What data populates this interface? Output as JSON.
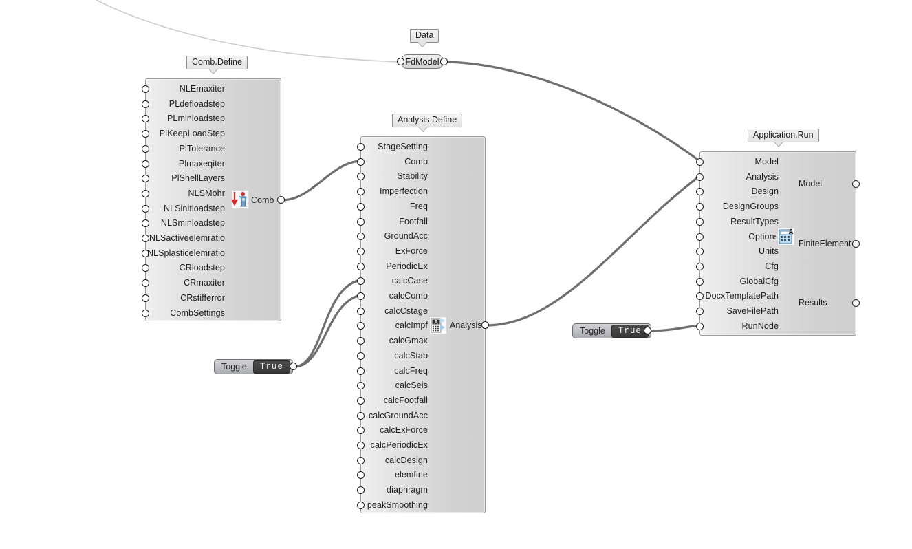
{
  "app": {
    "kind": "node-graph-canvas",
    "background": "#ffffff",
    "wire_color": "#6e6e6e",
    "thin_wire_color": "#c9c9c9"
  },
  "nodes": [
    {
      "id": "comb-define",
      "tag": "Comb.Define",
      "icon_name": "comb-icon",
      "output_label": "Comb",
      "inputs": [
        "NLEmaxiter",
        "PLdefloadstep",
        "PLminloadstep",
        "PlKeepLoadStep",
        "PlTolerance",
        "Plmaxeqiter",
        "PlShellLayers",
        "NLSMohr",
        "NLSinitloadstep",
        "NLSminloadstep",
        "NLSactiveelemratio",
        "NLSplasticelemratio",
        "CRloadstep",
        "CRmaxiter",
        "CRstifferror",
        "CombSettings"
      ],
      "outputs": [
        "Comb"
      ]
    },
    {
      "id": "analysis-define",
      "tag": "Analysis.Define",
      "icon_name": "analysis-icon",
      "output_label": "Analysis",
      "inputs": [
        "StageSetting",
        "Comb",
        "Stability",
        "Imperfection",
        "Freq",
        "Footfall",
        "GroundAcc",
        "ExForce",
        "PeriodicEx",
        "calcCase",
        "calcComb",
        "calcCstage",
        "calcImpf",
        "calcGmax",
        "calcStab",
        "calcFreq",
        "calcSeis",
        "calcFootfall",
        "calcGroundAcc",
        "calcExForce",
        "calcPeriodicEx",
        "calcDesign",
        "elemfine",
        "diaphragm",
        "peakSmoothing"
      ],
      "outputs": [
        "Analysis"
      ]
    },
    {
      "id": "application-run",
      "tag": "Application.Run",
      "icon_name": "finite-element-icon",
      "inputs": [
        "Model",
        "Analysis",
        "Design",
        "DesignGroups",
        "ResultTypes",
        "Options",
        "Units",
        "Cfg",
        "GlobalCfg",
        "DocxTemplatePath",
        "SaveFilePath",
        "RunNode"
      ],
      "outputs": [
        "Model",
        "FiniteElement",
        "Results"
      ]
    }
  ],
  "param_capsule": {
    "id": "fdmodel",
    "tag": "Data",
    "label": "FdModel"
  },
  "toggles": [
    {
      "id": "toggle-left",
      "label": "Toggle",
      "value": "True"
    },
    {
      "id": "toggle-right",
      "label": "Toggle",
      "value": "True"
    }
  ]
}
